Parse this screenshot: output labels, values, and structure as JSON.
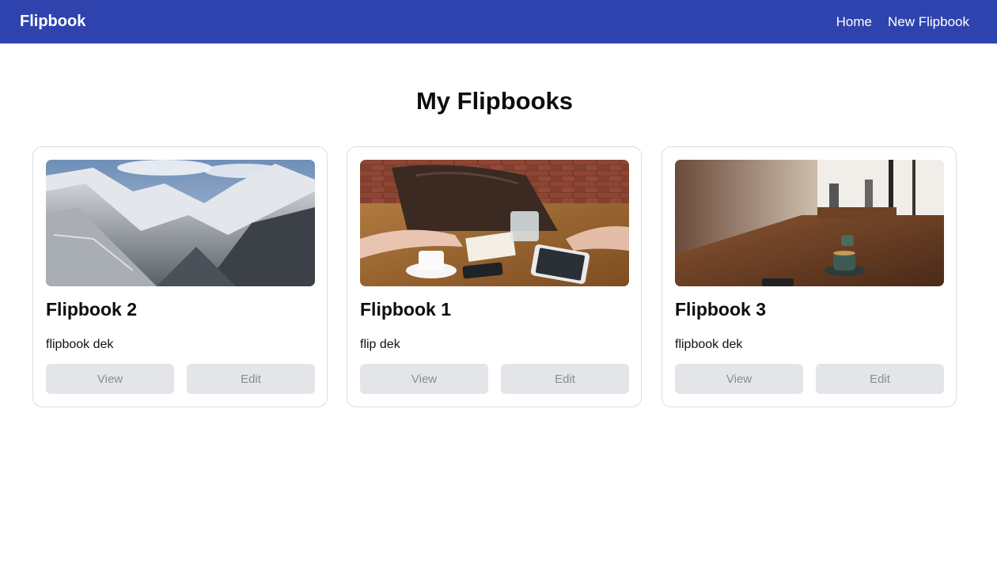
{
  "navbar": {
    "brand": "Flipbook",
    "links": [
      {
        "label": "Home"
      },
      {
        "label": "New Flipbook"
      }
    ]
  },
  "page": {
    "title": "My Flipbooks"
  },
  "colors": {
    "navbar_bg": "#2f43ae",
    "button_bg": "#e4e5e9",
    "button_text": "#8a8c93",
    "card_border": "#dcdde3"
  },
  "cards": [
    {
      "title": "Flipbook 2",
      "description": "flipbook dek",
      "image": "snowy-mountain-valley-photo",
      "view_label": "View",
      "edit_label": "Edit"
    },
    {
      "title": "Flipbook 1",
      "description": "flip dek",
      "image": "table-with-coffee-and-tablet-photo",
      "view_label": "View",
      "edit_label": "Edit"
    },
    {
      "title": "Flipbook 3",
      "description": "flipbook dek",
      "image": "cafe-wooden-table-photo",
      "view_label": "View",
      "edit_label": "Edit"
    }
  ]
}
